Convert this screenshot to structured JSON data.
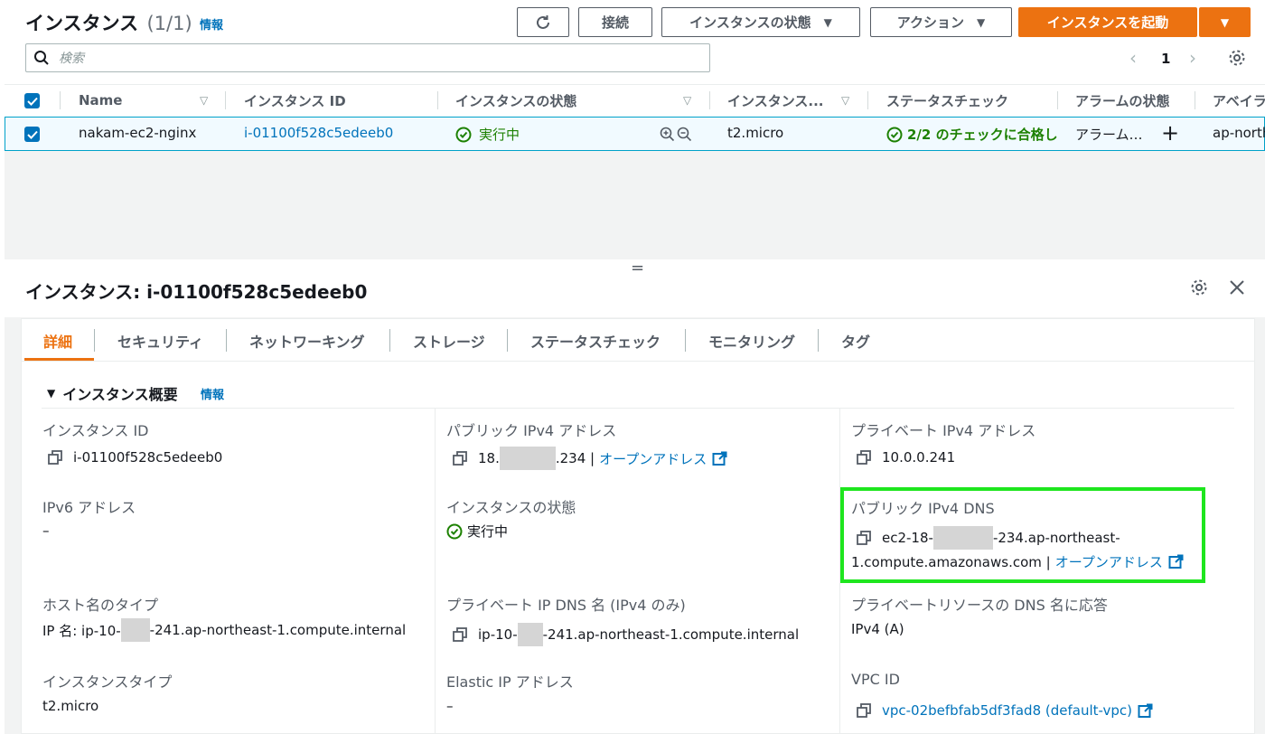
{
  "header": {
    "title": "インスタンス",
    "count": "(1/1)",
    "info": "情報",
    "buttons": {
      "connect": "接続",
      "instance_state": "インスタンスの状態",
      "actions": "アクション",
      "launch": "インスタンスを起動"
    },
    "search_placeholder": "検索",
    "page": "1"
  },
  "table": {
    "columns": [
      "Name",
      "インスタンス ID",
      "インスタンスの状態",
      "インスタンス...",
      "ステータスチェック",
      "アラームの状態",
      "アベイラ"
    ],
    "row": {
      "name": "nakam-ec2-nginx",
      "instance_id": "i-01100f528c5edeeb0",
      "state": "実行中",
      "type": "t2.micro",
      "status_check": "2/2 のチェックに合格し",
      "alarm": "アラーム…",
      "az": "ap-north"
    }
  },
  "detail": {
    "title": "インスタンス: i-01100f528c5edeeb0",
    "tabs": [
      "詳細",
      "セキュリティ",
      "ネットワーキング",
      "ストレージ",
      "ステータスチェック",
      "モニタリング",
      "タグ"
    ],
    "section_title": "インスタンス概要",
    "section_info": "情報",
    "fields": {
      "instance_id_label": "インスタンス ID",
      "instance_id_value": "i-01100f528c5edeeb0",
      "public_ipv4_label": "パブリック IPv4 アドレス",
      "public_ipv4_prefix": "18.",
      "public_ipv4_suffix": ".234 |",
      "open_address": "オープンアドレス",
      "private_ipv4_label": "プライベート IPv4 アドレス",
      "private_ipv4_value": "10.0.0.241",
      "ipv6_label": "IPv6 アドレス",
      "ipv6_value": "–",
      "state_label": "インスタンスの状態",
      "state_value": "実行中",
      "public_dns_label": "パブリック IPv4 DNS",
      "public_dns_prefix": "ec2-18-",
      "public_dns_suffix": "-234.ap-northeast-",
      "public_dns_line2": "1.compute.amazonaws.com |",
      "hostname_type_label": "ホスト名のタイプ",
      "hostname_type_prefix": "IP 名: ip-10-",
      "hostname_type_suffix": "-241.ap-northeast-1.compute.internal",
      "private_dns_label": "プライベート IP DNS 名 (IPv4 のみ)",
      "private_dns_prefix": "ip-10-",
      "private_dns_suffix": "-241.ap-northeast-1.compute.internal",
      "private_resource_dns_label": "プライベートリソースの DNS 名に応答",
      "private_resource_dns_value": "IPv4 (A)",
      "instance_type_label": "インスタンスタイプ",
      "instance_type_value": "t2.micro",
      "elastic_ip_label": "Elastic IP アドレス",
      "elastic_ip_value": "–",
      "vpc_id_label": "VPC ID",
      "vpc_id_value": "vpc-02befbfab5df3fad8 (default-vpc)"
    }
  },
  "colors": {
    "accent": "#ec7211",
    "link": "#0073bb",
    "success": "#1d8102",
    "highlight": "#1ee61e"
  }
}
